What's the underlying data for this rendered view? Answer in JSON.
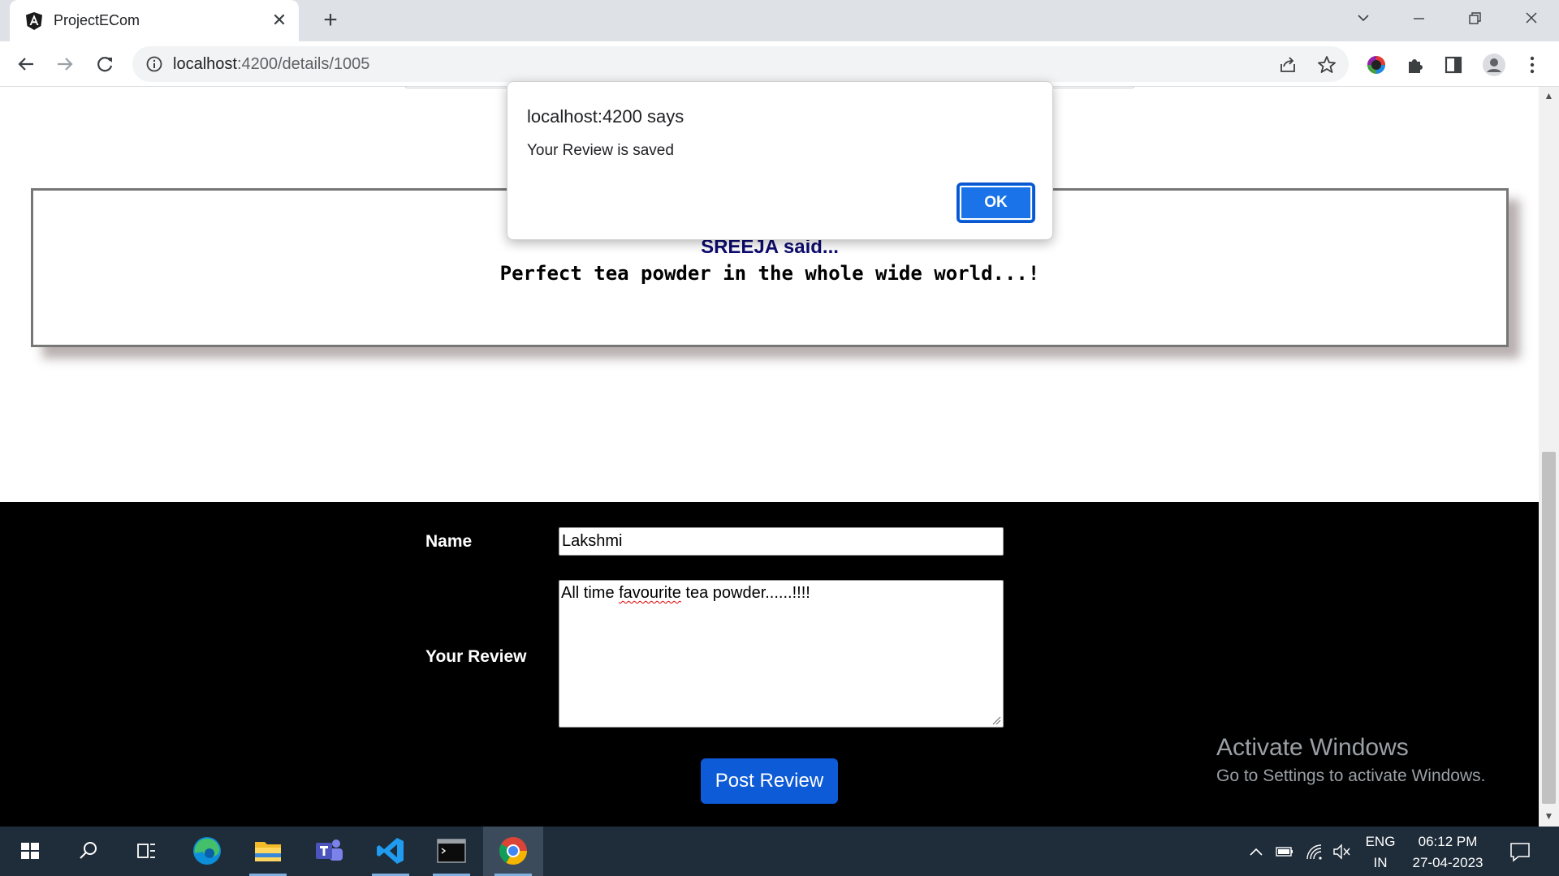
{
  "browser": {
    "tab_title": "ProjectECom",
    "url_host": "localhost",
    "url_rest": ":4200/details/1005"
  },
  "review": {
    "reviewer": "SREEJA said...",
    "text": "Perfect tea powder in the whole wide world...!"
  },
  "form": {
    "name_label": "Name",
    "name_value": "Lakshmi",
    "review_label": "Your Review",
    "review_value_prefix": "All time ",
    "review_value_misspelled": "favourite",
    "review_value_suffix": " tea powder......!!!!",
    "submit_label": "Post Review"
  },
  "dialog": {
    "title": "localhost:4200 says",
    "message": "Your Review is saved",
    "ok_label": "OK"
  },
  "watermark": {
    "title": "Activate Windows",
    "subtitle": "Go to Settings to activate Windows."
  },
  "taskbar": {
    "lang_top": "ENG",
    "lang_bottom": "IN",
    "time": "06:12 PM",
    "date": "27-04-2023"
  },
  "colors": {
    "accent_button": "#0d5bd7",
    "reviewer_name": "#0d0b6e",
    "form_background": "#000000"
  }
}
